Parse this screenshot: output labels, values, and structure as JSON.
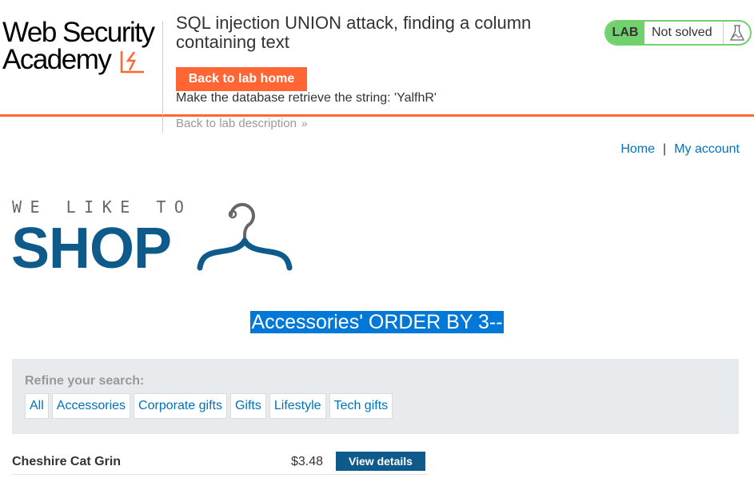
{
  "header": {
    "logo_line1": "Web Security",
    "logo_line2": "Academy",
    "lab_title": "SQL injection UNION attack, finding a column containing text",
    "back_home_label": "Back to lab home",
    "instruction": "Make the database retrieve the string: 'YalfhR'",
    "back_description_label": "Back to lab description",
    "lab_badge": "LAB",
    "lab_status": "Not solved",
    "accent_color": "#ff6633",
    "status_color": "#70d16d"
  },
  "nav": {
    "home_label": "Home",
    "separator": "|",
    "account_label": "My account"
  },
  "shop_logo": {
    "tagline": "WE LIKE TO",
    "word": "SHOP",
    "brand_color": "#0e5a8a"
  },
  "search": {
    "heading": "Accessories' ORDER BY 3--"
  },
  "filter": {
    "label": "Refine your search:",
    "categories": [
      "All",
      "Accessories",
      "Corporate gifts",
      "Gifts",
      "Lifestyle",
      "Tech gifts"
    ]
  },
  "products": [
    {
      "name": "Cheshire Cat Grin",
      "price": "$3.48",
      "action_label": "View details"
    }
  ]
}
